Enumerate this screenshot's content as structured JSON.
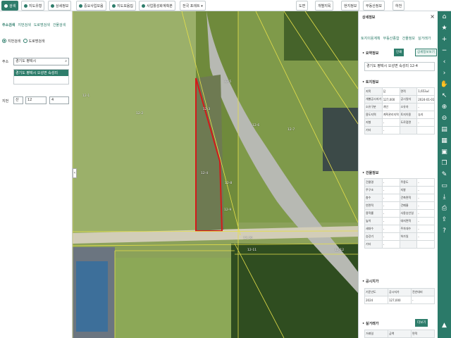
{
  "topbar": {
    "tabs": [
      {
        "label": "검색",
        "icon": "search-icon"
      },
      {
        "label": "지도유형",
        "icon": "layers-icon"
      },
      {
        "label": "상세정보",
        "icon": "info-icon"
      },
      {
        "label": "중요사업모음",
        "icon": "folder-icon"
      },
      {
        "label": "지도모음집",
        "icon": "map-icon"
      },
      {
        "label": "사업활성화계획본",
        "icon": "doc-icon"
      }
    ],
    "region_label": "전국",
    "region_value": "포레트",
    "right_tabs": [
      "도면",
      "개별지목",
      "현지정보",
      "부동산정보",
      "하천"
    ]
  },
  "left_panel": {
    "tabs": [
      "주소검색",
      "지번검색",
      "도로명검색",
      "건물검색"
    ],
    "radio_jibun": "지번검색",
    "radio_road": "도로명검색",
    "address_label": "주소",
    "address_value": "경기도 평택시",
    "suggestion": "경기도 평택시 오성면 숙성리",
    "jibun_label": "지번",
    "jibun_main": "산",
    "jibun_number": "12",
    "jibun_sub": "4"
  },
  "map": {
    "labels": [
      "12-1",
      "12-2",
      "12-3",
      "12-4",
      "12-5",
      "12-6",
      "12-7",
      "12-8",
      "12-9",
      "12-10",
      "12-11",
      "12-12"
    ]
  },
  "right_panel": {
    "title": "상세정보",
    "close": "×",
    "subtabs": [
      "토지이용계획",
      "부동산종합",
      "건물정보",
      "실거래가"
    ],
    "section_summary": "• 요약정보",
    "btn_print": "인쇄",
    "btn_detail": "상세정보보기",
    "address": "경기도 평택시 오성면 숙성리 12-4",
    "section_land": "• 토지정보",
    "land_rows": [
      [
        "지목",
        "답",
        "면적",
        "1,653㎡"
      ],
      [
        "개별공시지가",
        "127,000",
        "공시일자",
        "2024-01-01"
      ],
      [
        "소유구분",
        "개인",
        "소유자",
        "-"
      ],
      [
        "용도지역",
        "계획관리지역",
        "토지이용",
        "농지"
      ],
      [
        "지형",
        "-",
        "도로접면",
        "-"
      ],
      [
        "기타",
        "-",
        "",
        ""
      ]
    ],
    "section_bldg": "• 건물정보",
    "bldg_rows": [
      [
        "건물명",
        "-",
        "주용도",
        "-"
      ],
      [
        "주구조",
        "-",
        "지붕",
        "-"
      ],
      [
        "층수",
        "-",
        "건축면적",
        "-"
      ],
      [
        "연면적",
        "-",
        "건폐율",
        "-"
      ],
      [
        "용적률",
        "-",
        "사용승인일",
        "-"
      ],
      [
        "높이",
        "-",
        "대지면적",
        "-"
      ],
      [
        "세대수",
        "-",
        "주차대수",
        "-"
      ],
      [
        "승강기",
        "-",
        "허가일",
        "-"
      ],
      [
        "기타",
        "-",
        "",
        ""
      ]
    ],
    "section_price": "• 공시지가",
    "price_header": [
      "기준년도",
      "공시지가",
      "전년대비"
    ],
    "price_row": [
      "2024",
      "127,000",
      "-"
    ],
    "section_trade": "• 실거래가",
    "btn_more": "더보기",
    "trade_header": [
      "거래일",
      "금액",
      "면적"
    ]
  },
  "toolbar": {
    "tools": [
      "home-icon",
      "star-icon",
      "plus-icon",
      "minus-icon",
      "arrow-left-icon",
      "arrow-right-icon",
      "hand-icon",
      "cursor-icon",
      "zoom-in-icon",
      "zoom-out-icon",
      "measure-icon",
      "grid-icon",
      "save-icon",
      "copy-icon",
      "pen-icon",
      "eraser-icon",
      "download-icon",
      "print-icon",
      "share-icon",
      "help-icon",
      "north-icon"
    ]
  }
}
